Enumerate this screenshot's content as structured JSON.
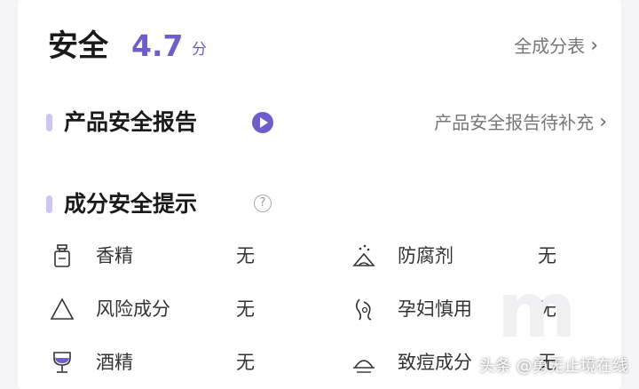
{
  "header": {
    "title": "安全",
    "score": "4.7",
    "score_unit": "分",
    "full_list_link": "全成分表",
    "accent_color": "#6f5ec9"
  },
  "report_section": {
    "title": "产品安全报告",
    "play_icon": "play-circle-icon",
    "pending_text": "产品安全报告待补充"
  },
  "hints_section": {
    "title": "成分安全提示",
    "help_icon": "question-circle-icon",
    "items": [
      {
        "icon": "perfume-bottle-icon",
        "label": "香精",
        "value": "无"
      },
      {
        "icon": "preservative-icon",
        "label": "防腐剂",
        "value": "无"
      },
      {
        "icon": "warning-triangle-icon",
        "label": "风险成分",
        "value": "无"
      },
      {
        "icon": "pregnancy-icon",
        "label": "孕妇慎用",
        "value": "无"
      },
      {
        "icon": "wine-glass-icon",
        "label": "酒精",
        "value": "无"
      },
      {
        "icon": "acne-icon",
        "label": "致痘成分",
        "value": "无"
      }
    ]
  },
  "watermark": {
    "text": "头条 @勇无止境在线"
  }
}
